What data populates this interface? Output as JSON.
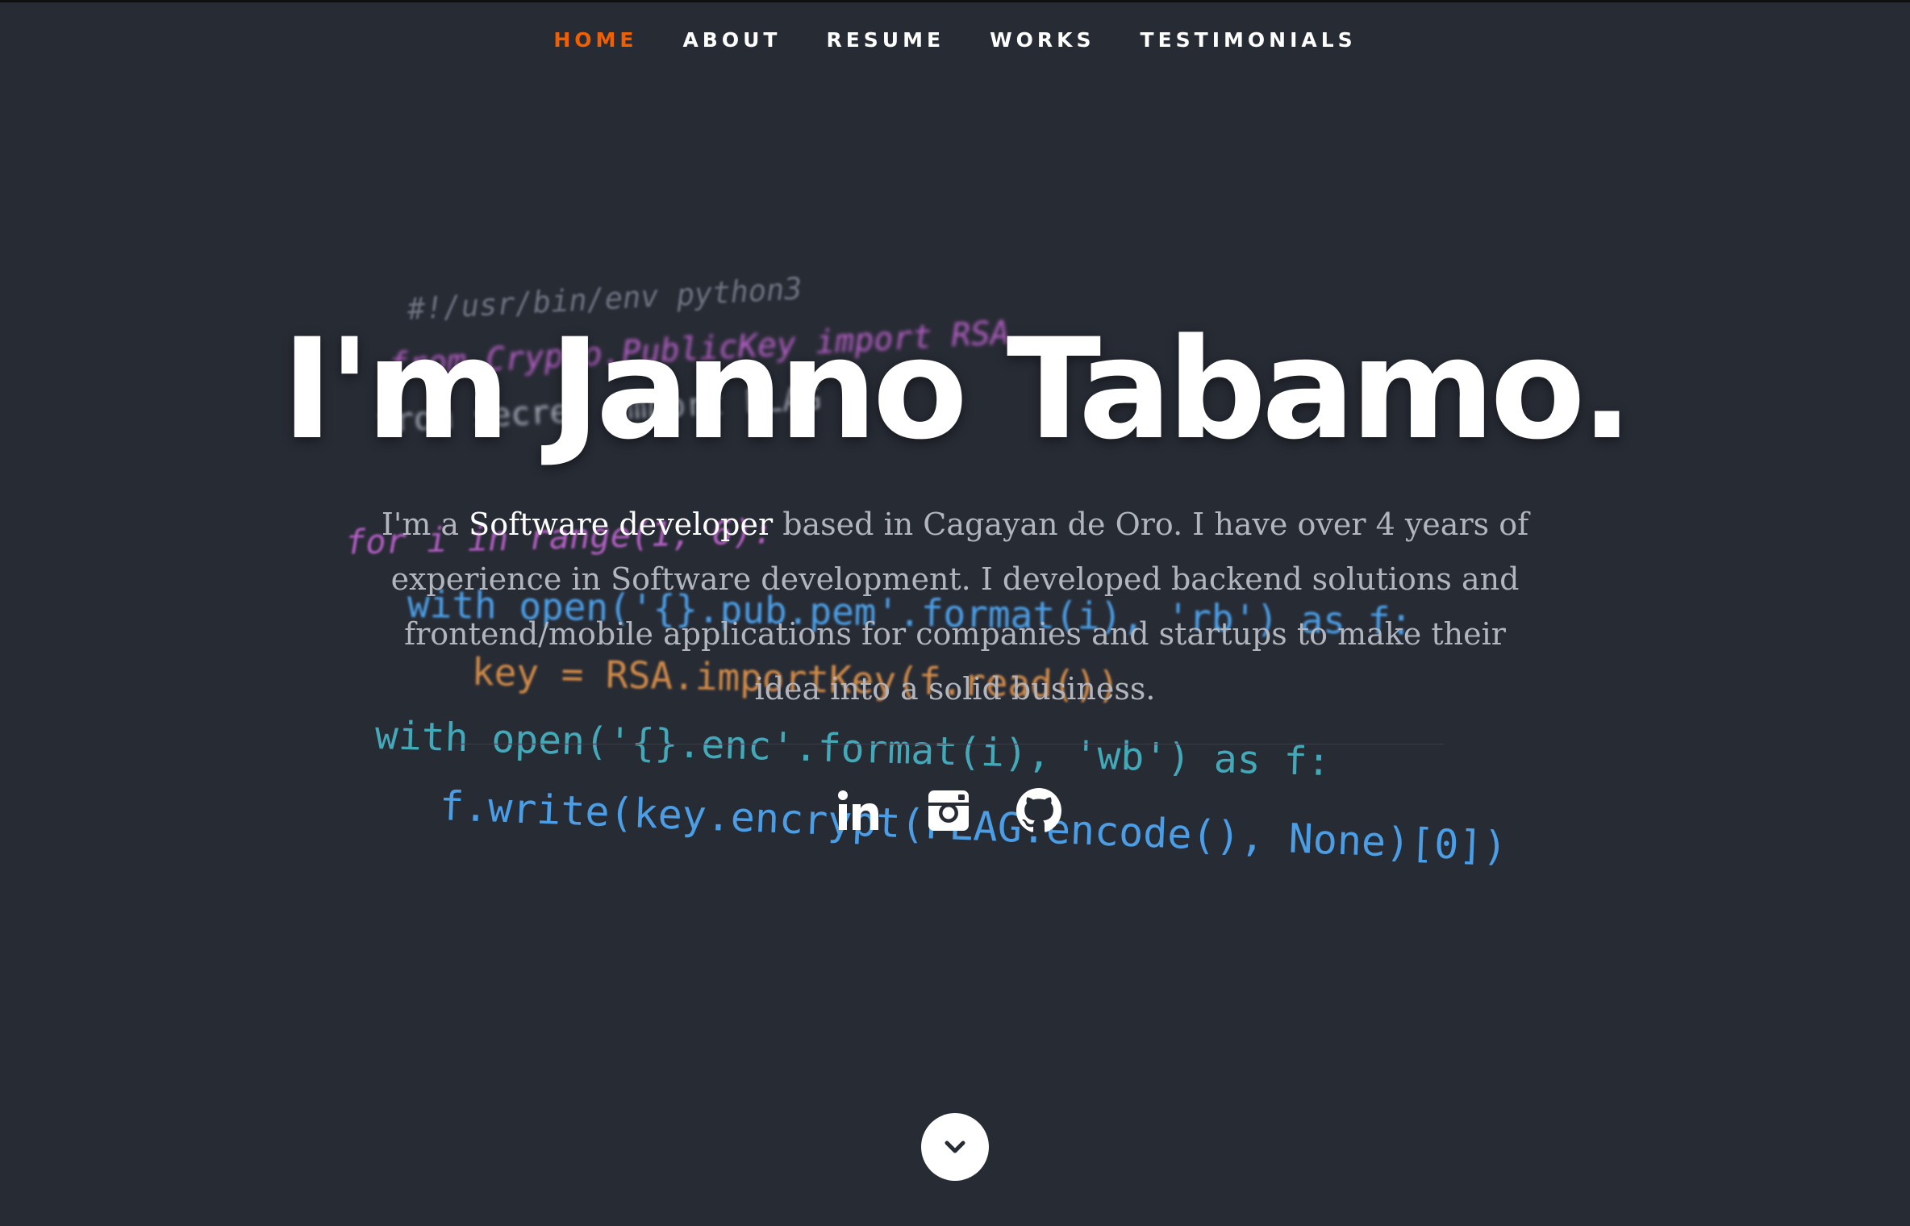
{
  "nav": {
    "items": [
      {
        "label": "HOME",
        "active": true
      },
      {
        "label": "ABOUT",
        "active": false
      },
      {
        "label": "RESUME",
        "active": false
      },
      {
        "label": "WORKS",
        "active": false
      },
      {
        "label": "TESTIMONIALS",
        "active": false
      }
    ]
  },
  "hero": {
    "headline": "I'm Janno Tabamo.",
    "intro_prefix": "I'm a ",
    "intro_highlight": "Software developer",
    "intro_suffix": " based in Cagayan de Oro. I have over 4 years of experience in Software development. I developed backend solutions and frontend/mobile applications for companies and startups to make their idea into a solid business."
  },
  "background_code": {
    "lines": [
      "#!/usr/bin/env python3",
      "from Crypto.PublicKey import RSA",
      "from secret import FLAG",
      "for i in range(1, 6):",
      "with open('{}.pub.pem'.format(i), 'rb') as f:",
      "key = RSA.importKey(f.read())",
      "with open('{}.enc'.format(i), 'wb') as f:",
      "f.write(key.encrypt(FLAG.encode(), None)[0])"
    ]
  },
  "social": {
    "items": [
      {
        "icon": "linkedin-icon"
      },
      {
        "icon": "instagram-icon"
      },
      {
        "icon": "github-icon"
      }
    ]
  },
  "scroll": {
    "icon": "chevron-down-icon"
  },
  "colors": {
    "background": "#272b34",
    "accent": "#f06000",
    "text": "#ffffff",
    "intro_text": "#b2b5bd"
  }
}
